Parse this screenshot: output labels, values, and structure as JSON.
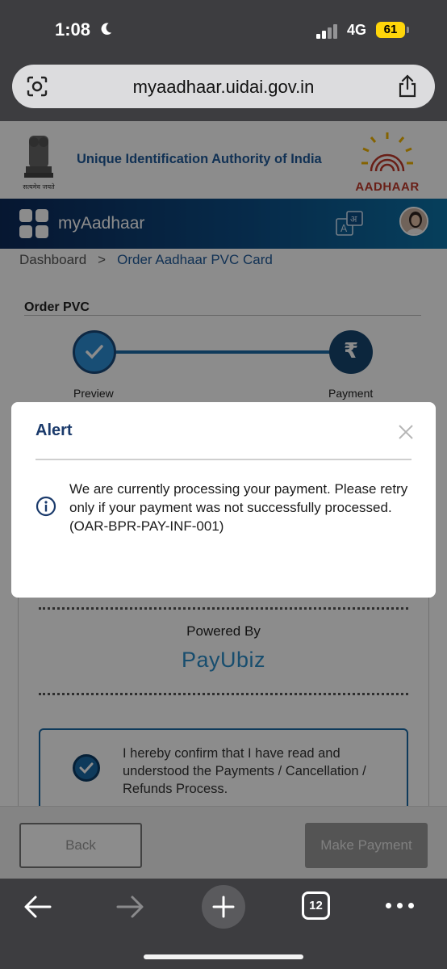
{
  "status_bar": {
    "time": "1:08",
    "network": "4G",
    "battery": "61"
  },
  "browser": {
    "url": "myaadhaar.uidai.gov.in",
    "tab_count": "12"
  },
  "header": {
    "org_name": "Unique Identification Authority of India",
    "emblem_caption": "सत्यमेव जयते",
    "aadhaar_logo_text": "AADHAAR"
  },
  "nav": {
    "app_title": "myAadhaar"
  },
  "breadcrumb": {
    "home": "Dashboard",
    "separator": ">",
    "current": "Order Aadhaar PVC Card"
  },
  "order": {
    "title": "Order PVC",
    "steps": [
      {
        "label": "Preview"
      },
      {
        "label": "Payment"
      }
    ]
  },
  "payment": {
    "powered_by": "Powered By",
    "gateway": "PayUbiz",
    "confirm_text": "I hereby confirm that I have read and understood the Payments / Cancellation / Refunds Process."
  },
  "actions": {
    "back": "Back",
    "make_payment": "Make Payment"
  },
  "alert": {
    "title": "Alert",
    "message": "We are currently processing your payment. Please retry only if your payment was not successfully processed.(OAR-BPR-PAY-INF-001)"
  },
  "colors": {
    "brand_blue": "#1f5a9a",
    "accent": "#1b6aa6",
    "alert_title": "#1a3a6b"
  }
}
